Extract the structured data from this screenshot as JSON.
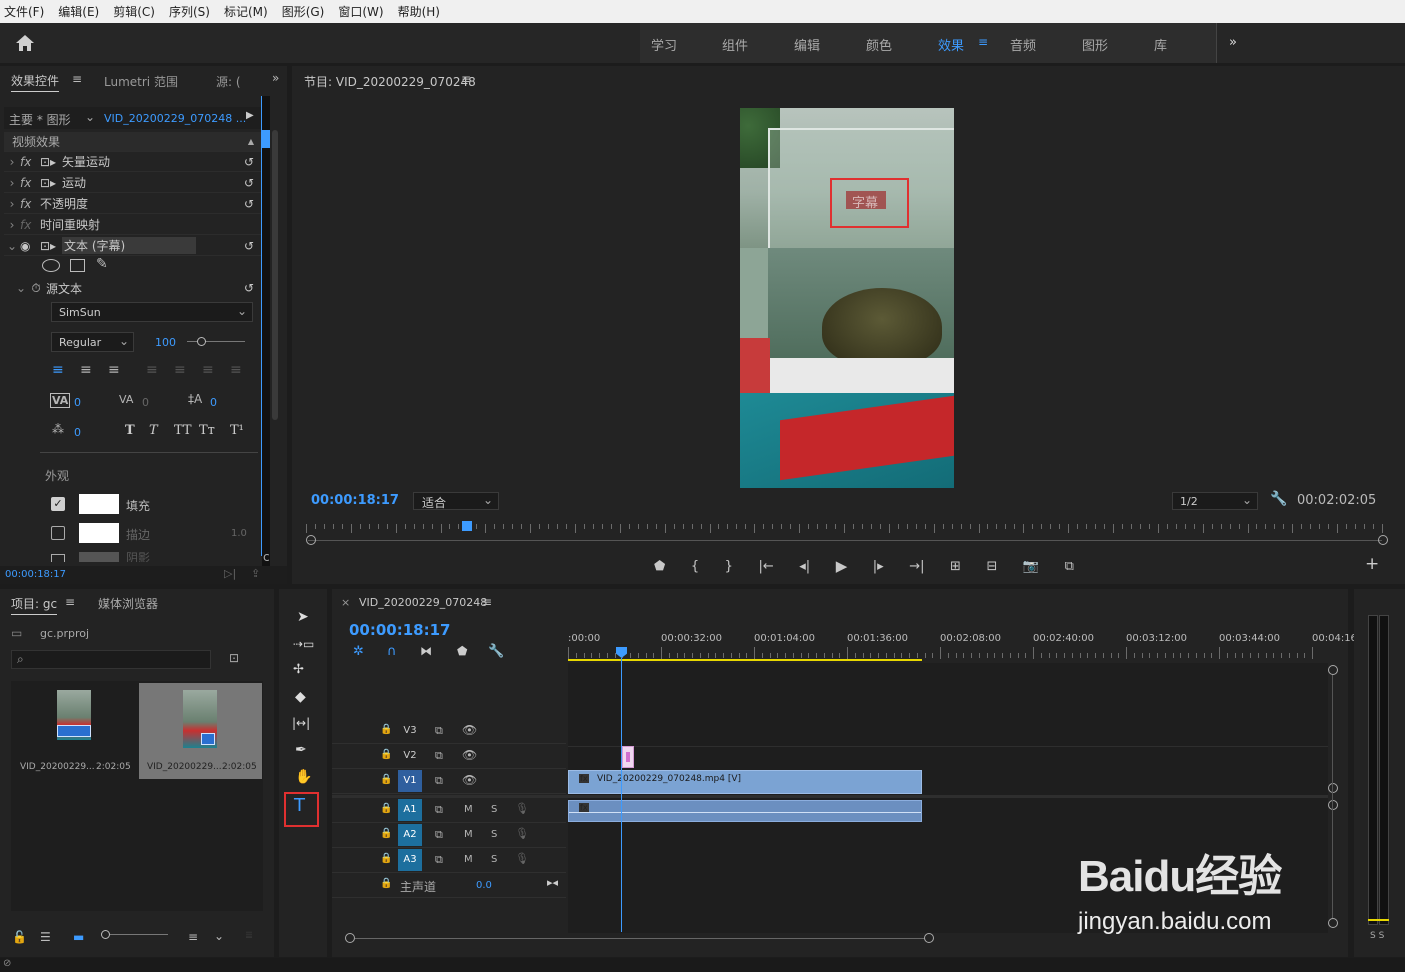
{
  "menu": [
    "文件(F)",
    "编辑(E)",
    "剪辑(C)",
    "序列(S)",
    "标记(M)",
    "图形(G)",
    "窗口(W)",
    "帮助(H)"
  ],
  "workspaces": [
    "学习",
    "组件",
    "编辑",
    "颜色",
    "效果",
    "音频",
    "图形",
    "库"
  ],
  "active_workspace": "效果",
  "effect_controls": {
    "tabs": [
      "效果控件",
      "Lumetri 范围",
      "源: ("
    ],
    "master": "主要 * 图形",
    "clip": "VID_20200229_070248 ...",
    "section": "视频效果",
    "effects": [
      "矢量运动",
      "运动",
      "不透明度",
      "时间重映射",
      "文本 (字幕)"
    ],
    "source_text": "源文本",
    "font": "SimSun",
    "style": "Regular",
    "size": "100",
    "kern_val": "0",
    "track_val": "0",
    "lead_val": "0",
    "baseline_val": "0",
    "appearance": "外观",
    "fill": "填充",
    "stroke": "描边",
    "stroke_val": "1.0",
    "shadow": "阴影",
    "timecode": "00:00:18:17"
  },
  "program": {
    "title": "节目: VID_20200229_070248",
    "timecode": "00:00:18:17",
    "fit": "适合",
    "resolution": "1/2",
    "duration": "00:02:02:05",
    "caption_text": "字幕",
    "progress": 0.15
  },
  "project": {
    "tabs": [
      "项目: gc",
      "媒体浏览器"
    ],
    "file": "gc.prproj",
    "search_placeholder": "",
    "items": [
      {
        "name": "VID_20200229...",
        "dur": "2:02:05"
      },
      {
        "name": "VID_20200229...",
        "dur": "2:02:05"
      }
    ]
  },
  "timeline": {
    "tab": "VID_20200229_070248",
    "timecode": "00:00:18:17",
    "ruler": [
      ":00:00",
      "00:00:32:00",
      "00:01:04:00",
      "00:01:36:00",
      "00:02:08:00",
      "00:02:40:00",
      "00:03:12:00",
      "00:03:44:00",
      "00:04:16"
    ],
    "video_tracks": [
      "V3",
      "V2",
      "V1"
    ],
    "audio_tracks": [
      "A1",
      "A2",
      "A3"
    ],
    "clip_label": "VID_20200229_070248.mp4 [V]",
    "master": "主声道",
    "master_val": "0.0",
    "m": "M",
    "s": "S"
  },
  "meter": {
    "labels": "S S"
  },
  "watermark": {
    "logo": "Baidu经验",
    "url": "jingyan.baidu.com"
  },
  "colors": {
    "accent": "#3d9bff",
    "clip_video": "#7ba3d3",
    "clip_audio": "#6b8fc0",
    "highlight": "#e03030"
  }
}
